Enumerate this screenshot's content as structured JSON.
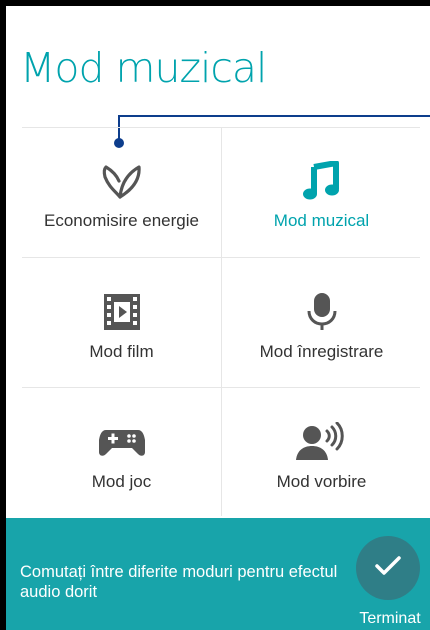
{
  "title": "Mod muzical",
  "modes": [
    {
      "label": "Economisire energie",
      "icon": "leaf-icon",
      "active": false
    },
    {
      "label": "Mod muzical",
      "icon": "music-note-icon",
      "active": true
    },
    {
      "label": "Mod film",
      "icon": "film-icon",
      "active": false
    },
    {
      "label": "Mod înregistrare",
      "icon": "microphone-icon",
      "active": false
    },
    {
      "label": "Mod joc",
      "icon": "gamepad-icon",
      "active": false
    },
    {
      "label": "Mod vorbire",
      "icon": "speaking-person-icon",
      "active": false
    }
  ],
  "footer": {
    "message": "Comutați între diferite moduri pentru efectul audio dorit",
    "done_label": "Terminat",
    "done_icon": "check-icon"
  },
  "colors": {
    "accent": "#00a3ad",
    "footer_bg": "#18a4aa",
    "done_button": "#2f7e87",
    "guide_line": "#0d3d8c",
    "icon_gray": "#555555"
  }
}
